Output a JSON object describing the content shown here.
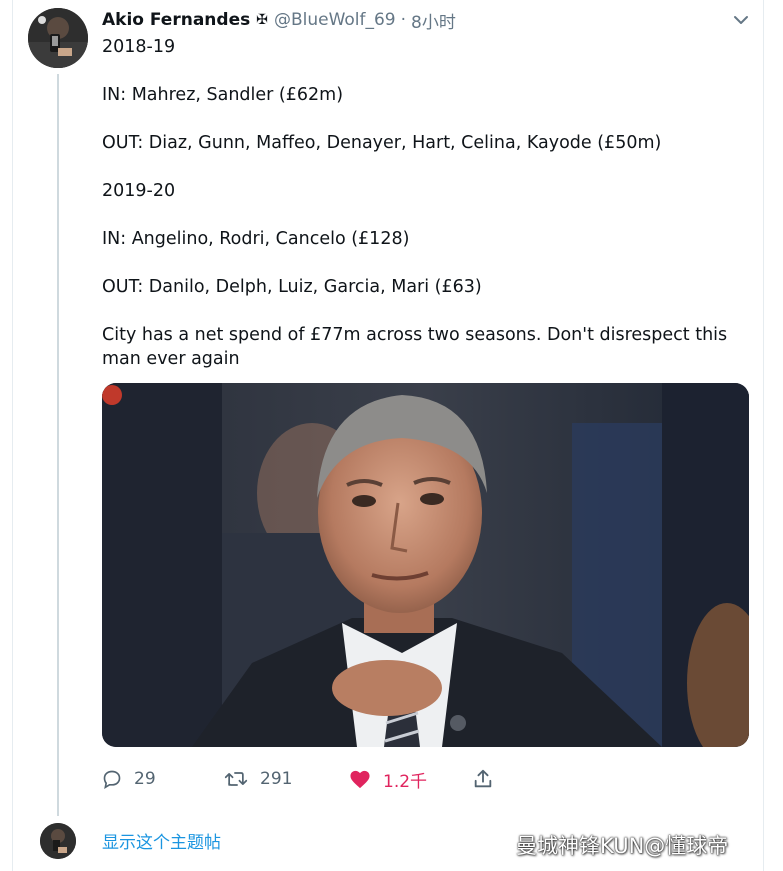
{
  "tweet": {
    "display_name": "Akio Fernandes",
    "name_badge": "✠",
    "handle": "@BlueWolf_69",
    "separator": "·",
    "time": "8小时",
    "lines": [
      "2018-19",
      "IN: Mahrez, Sandler (£62m)",
      "OUT: Diaz, Gunn, Maffeo, Denayer, Hart, Celina, Kayode (£50m)",
      "2019-20",
      "IN: Angelino, Rodri, Cancelo (£128)",
      "OUT: Danilo, Delph, Luiz, Garcia, Mari (£63)",
      "City has a net spend of £77m across two seasons. Don't disrespect this",
      "man ever again"
    ],
    "actions": {
      "reply_count": "29",
      "retweet_count": "291",
      "like_count": "1.2千"
    },
    "show_thread": "显示这个主题帖"
  },
  "watermark": "曼城神锋KUN@懂球帝",
  "colors": {
    "text": "#0f1419",
    "muted": "#657786",
    "link": "#1b95e0",
    "like": "#e0245e",
    "thread_line": "#cfd9de"
  },
  "icons": {
    "reply": "reply-icon",
    "retweet": "retweet-icon",
    "like": "heart-filled-icon",
    "share": "share-icon",
    "more": "chevron-down-icon"
  }
}
